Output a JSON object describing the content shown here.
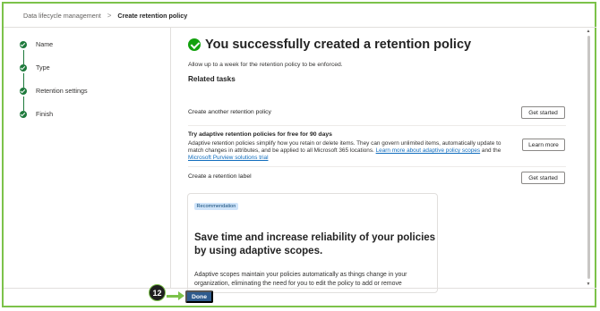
{
  "breadcrumb": {
    "parent": "Data lifecycle management",
    "separator": ">",
    "current": "Create retention policy"
  },
  "steps": [
    {
      "label": "Name",
      "status": "complete"
    },
    {
      "label": "Type",
      "status": "complete"
    },
    {
      "label": "Retention settings",
      "status": "complete"
    },
    {
      "label": "Finish",
      "status": "complete"
    }
  ],
  "main": {
    "title": "You successfully created a retention policy",
    "subtitle": "Allow up to a week for the retention policy to be enforced.",
    "related_heading": "Related tasks"
  },
  "tasks": [
    {
      "title": "Create another retention policy",
      "button": "Get started"
    },
    {
      "title": "Try adaptive retention policies for free for 90 days",
      "description": "Adaptive retention policies simplify how you retain or delete items. They can govern unlimited items, automatically update to match changes in attributes, and be applied to all Microsoft 365 locations.",
      "link1": "Learn more about adaptive policy scopes",
      "and_text": "and the",
      "link2": "Microsoft Purview solutions trial",
      "button": "Learn more"
    },
    {
      "title": "Create a retention label",
      "button": "Get started"
    }
  ],
  "card": {
    "badge": "Recommendation",
    "title": "Save time and increase reliability of your policies by using adaptive scopes.",
    "text": "Adaptive scopes maintain your policies automatically as things change in your organization, eliminating the need for you to edit the policy to add or remove"
  },
  "footer": {
    "done_label": "Done"
  },
  "annotation": {
    "step_number": "12"
  },
  "colors": {
    "accent": "#2e5b8e",
    "success": "#13a10e",
    "step_complete": "#1e7a3c",
    "frame_border": "#7cc24a",
    "link": "#0f6cbd"
  },
  "icons": {
    "success": "check-circle-icon",
    "step": "check-circle-icon",
    "scroll_up": "caret-up-icon",
    "scroll_down": "caret-down-icon"
  }
}
